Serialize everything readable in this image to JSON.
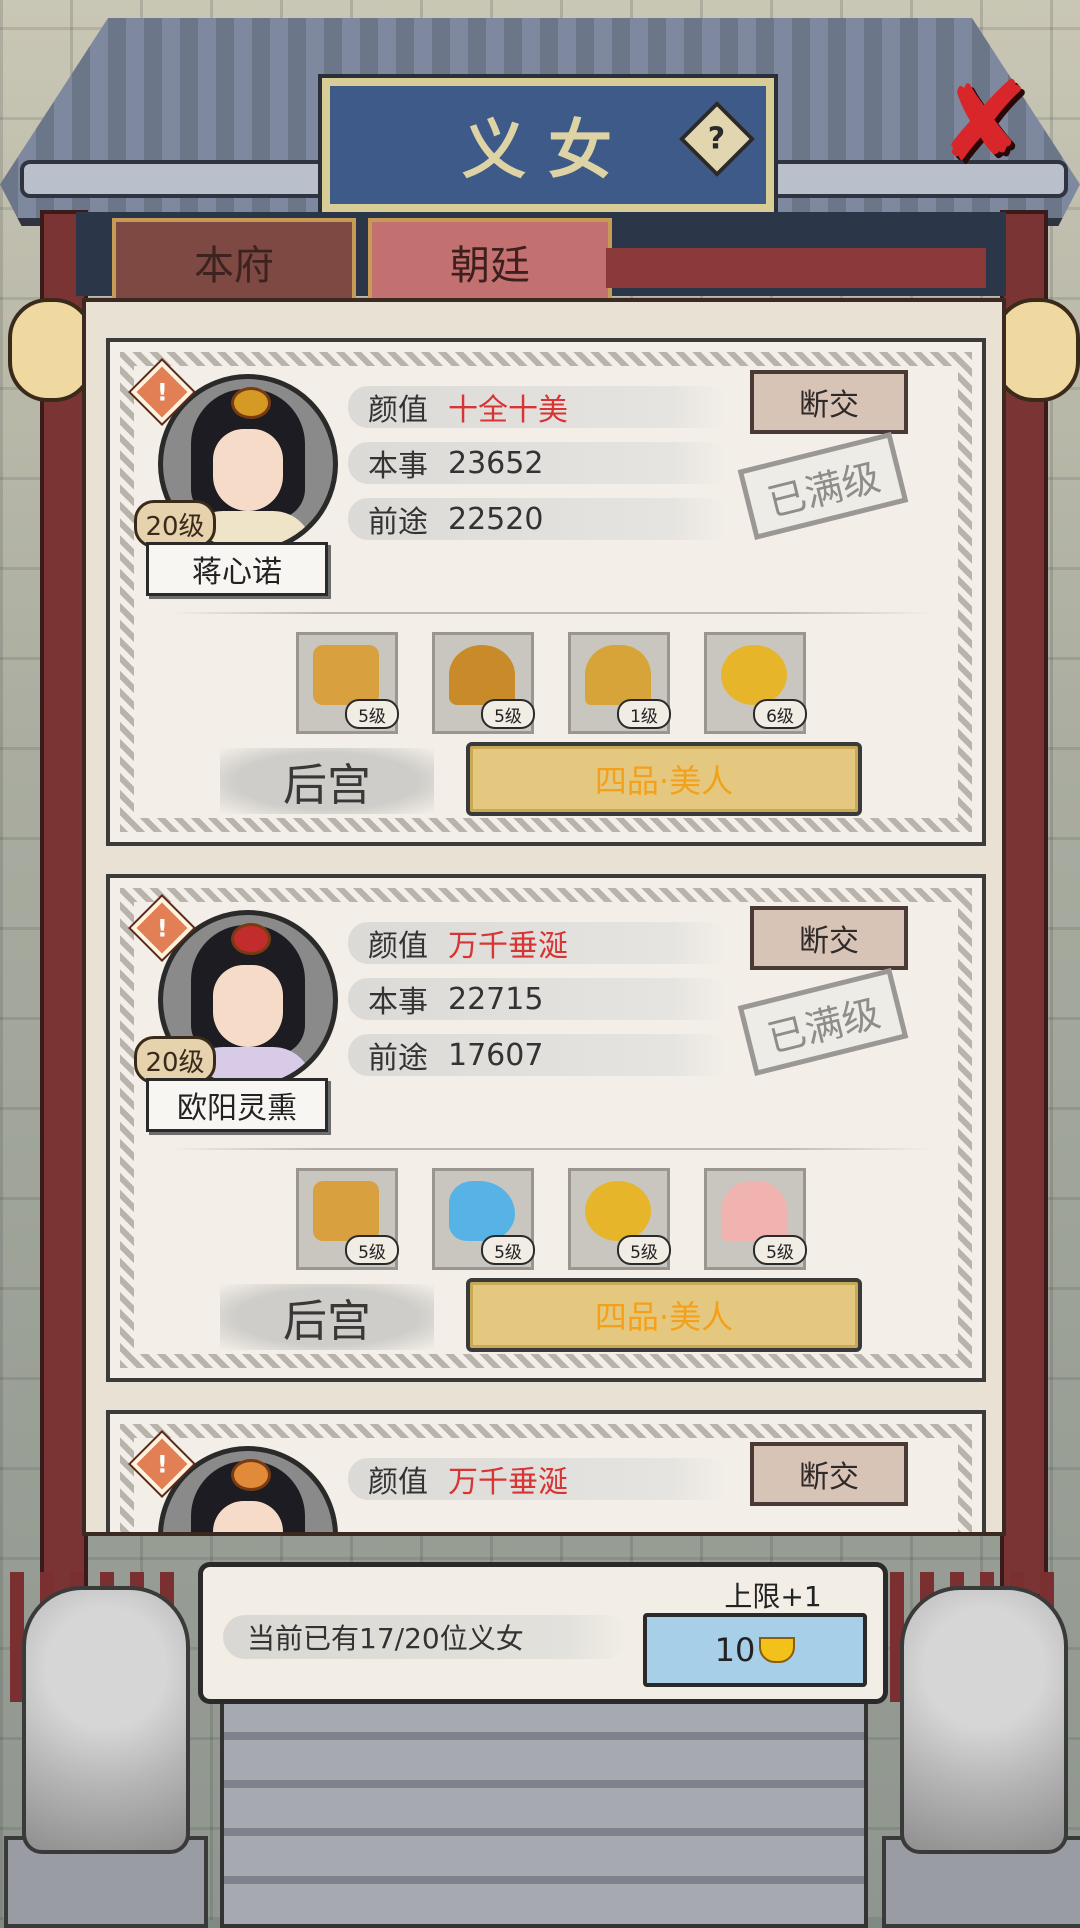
{
  "header": {
    "title": "义女",
    "help_icon": "question-icon",
    "close_icon": "close-x-icon",
    "help_glyph": "?",
    "close_glyph": "✘"
  },
  "tabs": [
    {
      "label": "本府",
      "active": false
    },
    {
      "label": "朝廷",
      "active": true
    }
  ],
  "cards": [
    {
      "level": "20级",
      "name": "蒋心诺",
      "stats": [
        {
          "key": "颜值",
          "value": "十全十美"
        },
        {
          "key": "本事",
          "value": "23652"
        },
        {
          "key": "前途",
          "value": "22520"
        }
      ],
      "breakup_label": "断交",
      "maxed_label": "已满级",
      "items": [
        {
          "icon": "scroll-case-icon",
          "level": "5级",
          "color": "#d9a040"
        },
        {
          "icon": "candelabra-icon",
          "level": "5级",
          "color": "#c98a2a"
        },
        {
          "icon": "robe-icon",
          "level": "1级",
          "color": "#d7a43a"
        },
        {
          "icon": "gold-hairpin-icon",
          "level": "6级",
          "color": "#e7b52a"
        }
      ],
      "harem_label": "后宫",
      "rank_label": "四品·美人"
    },
    {
      "level": "20级",
      "name": "欧阳灵熏",
      "stats": [
        {
          "key": "颜值",
          "value": "万千垂涎"
        },
        {
          "key": "本事",
          "value": "22715"
        },
        {
          "key": "前途",
          "value": "17607"
        }
      ],
      "breakup_label": "断交",
      "maxed_label": "已满级",
      "items": [
        {
          "icon": "scroll-case-icon",
          "level": "5级",
          "color": "#d9a040"
        },
        {
          "icon": "jade-ornament-icon",
          "level": "5级",
          "color": "#57b3e6"
        },
        {
          "icon": "gold-hairpin-icon",
          "level": "5级",
          "color": "#e7b52a"
        },
        {
          "icon": "pink-dress-icon",
          "level": "5级",
          "color": "#f0b3b0"
        }
      ],
      "harem_label": "后宫",
      "rank_label": "四品·美人"
    },
    {
      "level": "",
      "name": "",
      "stats": [
        {
          "key": "颜值",
          "value": "万千垂涎"
        }
      ],
      "breakup_label": "断交"
    }
  ],
  "footer": {
    "count_text": "当前已有17/20位义女",
    "limit_label": "上限+1",
    "cost": "10",
    "cost_icon": "gold-ingot-icon"
  },
  "warn_glyph": "!"
}
